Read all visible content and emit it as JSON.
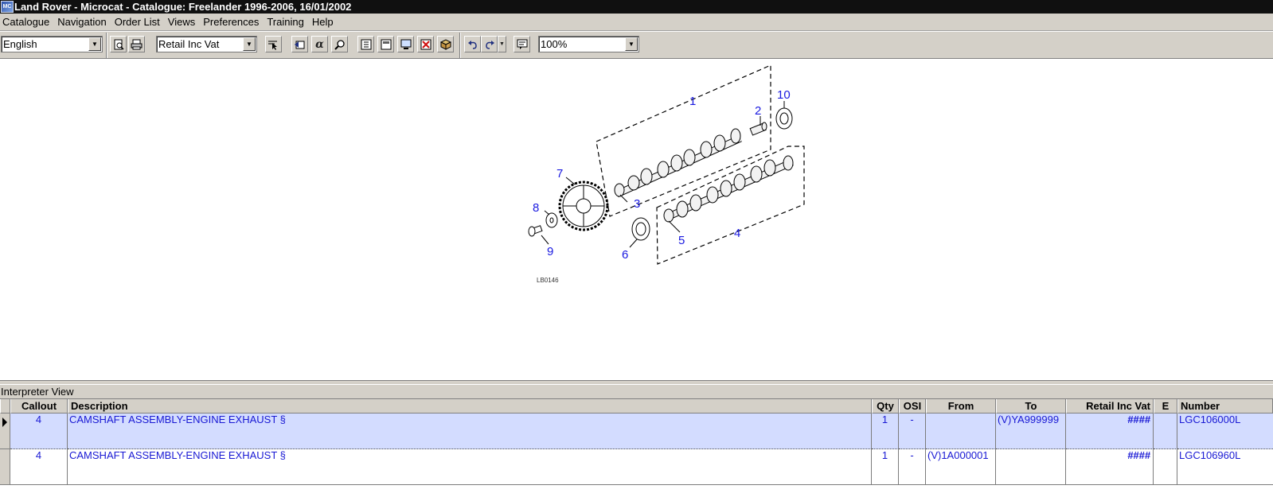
{
  "window": {
    "title": "Land Rover - Microcat - Catalogue: Freelander 1996-2006, 16/01/2002"
  },
  "menu": [
    "Catalogue",
    "Navigation",
    "Order List",
    "Views",
    "Preferences",
    "Training",
    "Help"
  ],
  "toolbar": {
    "language": "English",
    "price_type": "Retail Inc Vat",
    "zoom": "100%",
    "icons": [
      "print-preview-icon",
      "print-icon",
      "select-arrow-icon",
      "export-icon",
      "alpha-icon",
      "find-icon",
      "bookmark-icon",
      "list-icon",
      "monitor-icon",
      "close-x-icon",
      "catalogue-book-icon",
      "undo-icon",
      "redo-icon",
      "redo-menu-icon",
      "notes-icon"
    ]
  },
  "diagram": {
    "callouts": [
      "1",
      "2",
      "3",
      "4",
      "5",
      "6",
      "7",
      "8",
      "9",
      "10"
    ],
    "ref": "LB0146"
  },
  "interpreter": {
    "title": "Interpreter View",
    "columns": [
      "Callout",
      "Description",
      "Qty",
      "OSI",
      "From",
      "To",
      "Retail Inc Vat",
      "E",
      "Number"
    ],
    "rows": [
      {
        "callout": "4",
        "description": "CAMSHAFT ASSEMBLY-ENGINE EXHAUST §",
        "qty": "1",
        "osi": "-",
        "from": "",
        "to": "(V)YA999999",
        "price": "####",
        "e": "",
        "number": "LGC106000L"
      },
      {
        "callout": "4",
        "description": "CAMSHAFT ASSEMBLY-ENGINE EXHAUST §",
        "qty": "1",
        "osi": "-",
        "from": "(V)1A000001",
        "to": "",
        "price": "####",
        "e": "",
        "number": "LGC106960L"
      }
    ]
  },
  "colors": {
    "selected_row": "#d3dcff",
    "cell_text": "#1919d4",
    "callout_label": "#1a1ae0"
  }
}
